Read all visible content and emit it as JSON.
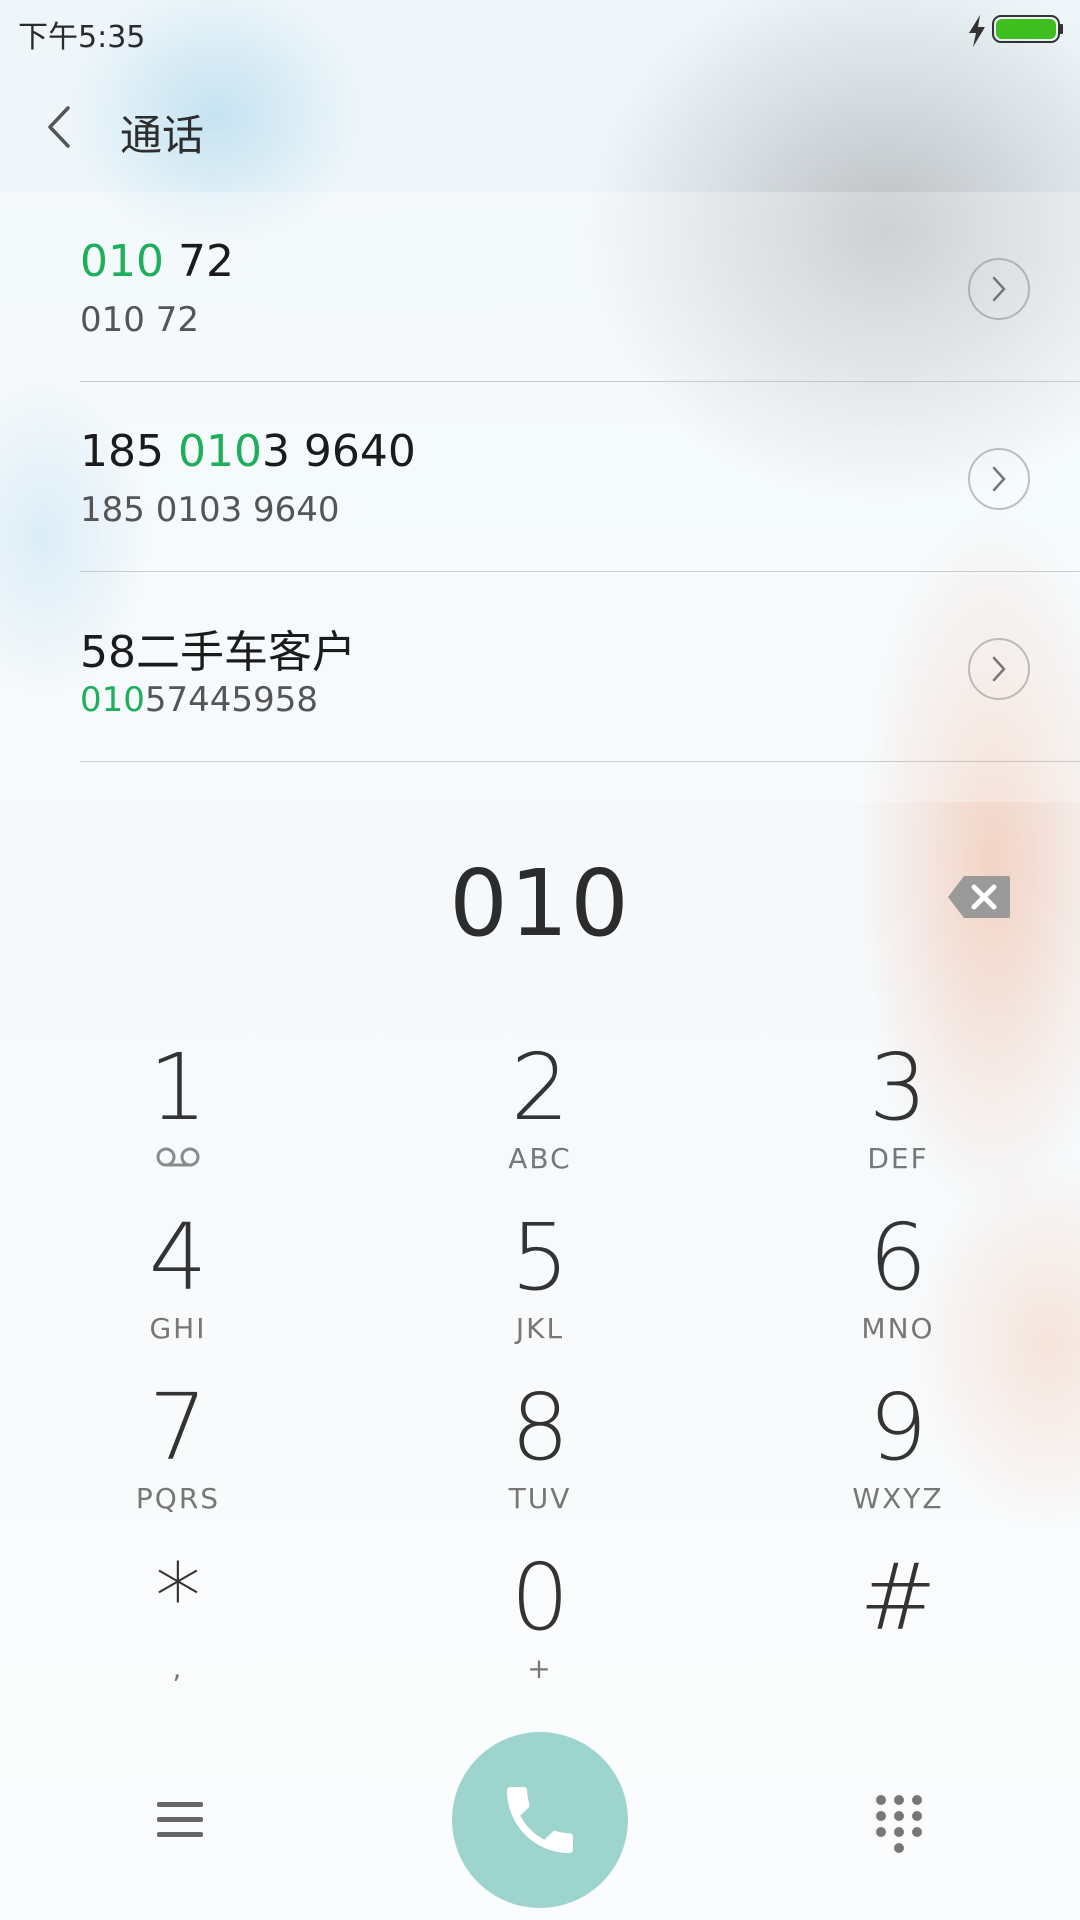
{
  "status_bar": {
    "time": "下午5:35"
  },
  "header": {
    "title": "通话"
  },
  "results": [
    {
      "primary_match": "010",
      "primary_rest": " 72",
      "primary_pre": "",
      "secondary_pre": "",
      "secondary_match": "",
      "secondary_rest": "010 72"
    },
    {
      "primary_pre": "185 ",
      "primary_match": "010",
      "primary_rest": "3 9640",
      "secondary_pre": "",
      "secondary_match": "",
      "secondary_rest": "185 0103 9640"
    },
    {
      "primary_pre": "58二手车客户",
      "primary_match": "",
      "primary_rest": "",
      "secondary_pre": "",
      "secondary_match": "010",
      "secondary_rest": "57445958"
    }
  ],
  "dialer": {
    "number": "010"
  },
  "keypad": {
    "keys": [
      {
        "digit": "1",
        "letters": ""
      },
      {
        "digit": "2",
        "letters": "ABC"
      },
      {
        "digit": "3",
        "letters": "DEF"
      },
      {
        "digit": "4",
        "letters": "GHI"
      },
      {
        "digit": "5",
        "letters": "JKL"
      },
      {
        "digit": "6",
        "letters": "MNO"
      },
      {
        "digit": "7",
        "letters": "PQRS"
      },
      {
        "digit": "8",
        "letters": "TUV"
      },
      {
        "digit": "9",
        "letters": "WXYZ"
      },
      {
        "digit": "*",
        "letters": ","
      },
      {
        "digit": "0",
        "letters": "+"
      },
      {
        "digit": "#",
        "letters": ""
      }
    ]
  },
  "icons": {
    "back": "back-arrow-icon",
    "detail": "chevron-right-circle-icon",
    "backspace": "backspace-icon",
    "voicemail": "voicemail-icon",
    "menu": "menu-icon",
    "call": "phone-icon",
    "dialpad": "dialpad-icon",
    "charging": "lightning-bolt-icon",
    "battery": "battery-icon"
  },
  "colors": {
    "match_highlight": "#1fae5c",
    "call_button": "#9dd4cd",
    "battery_fill": "#3fbf1f"
  }
}
